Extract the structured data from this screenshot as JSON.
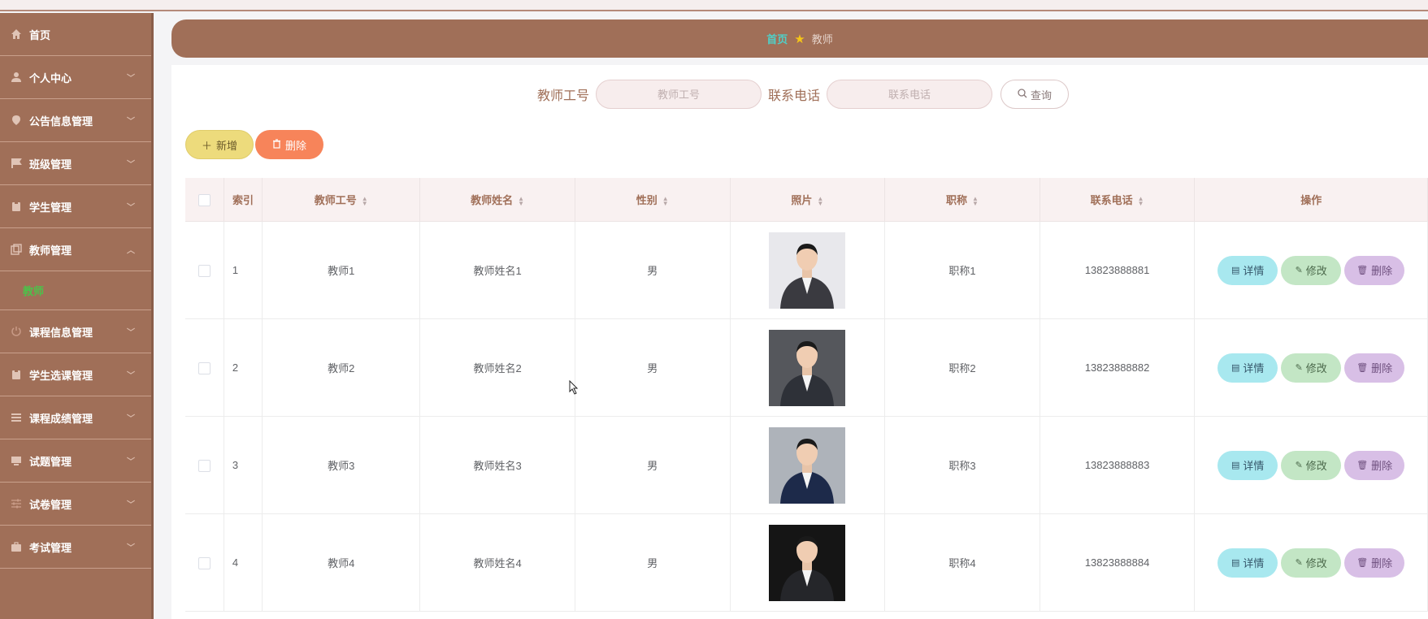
{
  "sidebar": {
    "items": [
      {
        "label": "首页",
        "icon": "home-icon",
        "has_chevron": false
      },
      {
        "label": "个人中心",
        "icon": "user-icon",
        "has_chevron": true
      },
      {
        "label": "公告信息管理",
        "icon": "location-icon",
        "has_chevron": true
      },
      {
        "label": "班级管理",
        "icon": "flag-icon",
        "has_chevron": true
      },
      {
        "label": "学生管理",
        "icon": "clipboard-icon",
        "has_chevron": true
      },
      {
        "label": "教师管理",
        "icon": "copy-icon",
        "has_chevron": true,
        "expanded": true
      },
      {
        "label": "课程信息管理",
        "icon": "power-icon",
        "has_chevron": true
      },
      {
        "label": "学生选课管理",
        "icon": "clipboard-icon",
        "has_chevron": true
      },
      {
        "label": "课程成绩管理",
        "icon": "list-icon",
        "has_chevron": true
      },
      {
        "label": "试题管理",
        "icon": "monitor-icon",
        "has_chevron": true
      },
      {
        "label": "试卷管理",
        "icon": "sliders-icon",
        "has_chevron": true
      },
      {
        "label": "考试管理",
        "icon": "briefcase-icon",
        "has_chevron": true
      }
    ],
    "submenu": {
      "label": "教师"
    }
  },
  "breadcrumb": {
    "home": "首页",
    "current": "教师"
  },
  "search": {
    "teacher_id_label": "教师工号",
    "teacher_id_placeholder": "教师工号",
    "phone_label": "联系电话",
    "phone_placeholder": "联系电话",
    "query_label": "查询"
  },
  "toolbar": {
    "add_label": "新增",
    "delete_label": "删除"
  },
  "table": {
    "headers": {
      "index": "索引",
      "teacher_id": "教师工号",
      "teacher_name": "教师姓名",
      "gender": "性别",
      "photo": "照片",
      "title": "职称",
      "phone": "联系电话",
      "actions": "操作"
    },
    "rows": [
      {
        "index": "1",
        "teacher_id": "教师1",
        "teacher_name": "教师姓名1",
        "gender": "男",
        "title": "职称1",
        "phone": "13823888881",
        "photo_bg": "#e8e8ec",
        "suit": "#3a3a40"
      },
      {
        "index": "2",
        "teacher_id": "教师2",
        "teacher_name": "教师姓名2",
        "gender": "男",
        "title": "职称2",
        "phone": "13823888882",
        "photo_bg": "#55575c",
        "suit": "#2e3138"
      },
      {
        "index": "3",
        "teacher_id": "教师3",
        "teacher_name": "教师姓名3",
        "gender": "男",
        "title": "职称3",
        "phone": "13823888883",
        "photo_bg": "#aeb3ba",
        "suit": "#1d2a4a"
      },
      {
        "index": "4",
        "teacher_id": "教师4",
        "teacher_name": "教师姓名4",
        "gender": "男",
        "title": "职称4",
        "phone": "13823888884",
        "photo_bg": "#151515",
        "suit": "#25262a"
      }
    ],
    "row_actions": {
      "detail": "详情",
      "edit": "修改",
      "delete": "删除"
    }
  },
  "colors": {
    "accent": "#a06f58",
    "active": "#4cc24a",
    "breadcrumb_home": "#4fd0c8"
  }
}
